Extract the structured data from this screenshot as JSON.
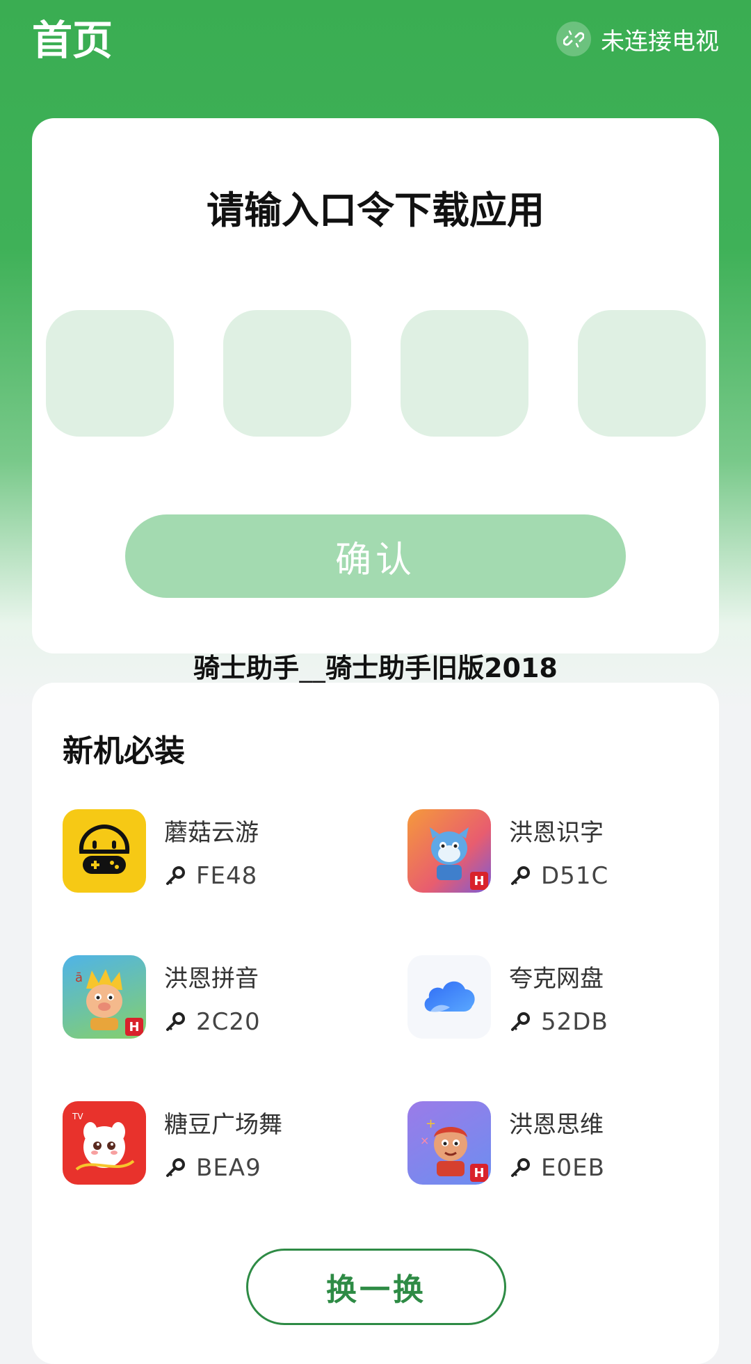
{
  "header": {
    "title": "首页",
    "tv_status": "未连接电视"
  },
  "code_card": {
    "title": "请输入口令下载应用",
    "code_inputs": [
      "",
      "",
      "",
      ""
    ],
    "confirm_label": "确认"
  },
  "watermark": "骑士助手__骑士助手旧版2018",
  "apps": {
    "section_title": "新机必装",
    "items": [
      {
        "name": "蘑菇云游",
        "code": "FE48",
        "icon": "mushroom-gamepad-icon"
      },
      {
        "name": "洪恩识字",
        "code": "D51C",
        "icon": "hongen-shizi-icon"
      },
      {
        "name": "洪恩拼音",
        "code": "2C20",
        "icon": "hongen-pinyin-icon"
      },
      {
        "name": "夸克网盘",
        "code": "52DB",
        "icon": "quark-cloud-icon"
      },
      {
        "name": "糖豆广场舞",
        "code": "BEA9",
        "icon": "tangdou-icon"
      },
      {
        "name": "洪恩思维",
        "code": "E0EB",
        "icon": "hongen-siwei-icon"
      }
    ],
    "swap_label": "换一换",
    "tv_badge": "TV",
    "hongen_badge": "H",
    "pinyin_glyph": "ā"
  },
  "colors": {
    "brand_green": "#3aad52",
    "confirm_disabled": "#a3dab0",
    "code_box": "#dff0e3",
    "swap_border": "#2e8b45"
  }
}
